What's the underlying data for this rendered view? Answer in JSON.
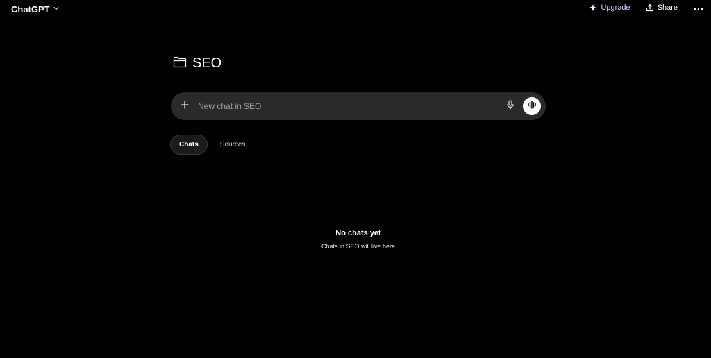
{
  "header": {
    "model_name": "ChatGPT",
    "upgrade_label": "Upgrade",
    "share_label": "Share"
  },
  "project": {
    "name": "SEO"
  },
  "composer": {
    "placeholder": "New chat in SEO"
  },
  "tabs": [
    {
      "label": "Chats",
      "active": true
    },
    {
      "label": "Sources",
      "active": false
    }
  ],
  "empty_state": {
    "title": "No chats yet",
    "subtitle": "Chats in SEO will live here"
  },
  "colors": {
    "background": "#000000",
    "composer_bg": "#2a2a2a",
    "upgrade_accent": "#d6d3ff"
  },
  "icons": [
    "chevron-down-icon",
    "sparkle-icon",
    "share-icon",
    "more-icon",
    "folder-icon",
    "plus-icon",
    "mic-icon",
    "voice-mode-icon"
  ]
}
